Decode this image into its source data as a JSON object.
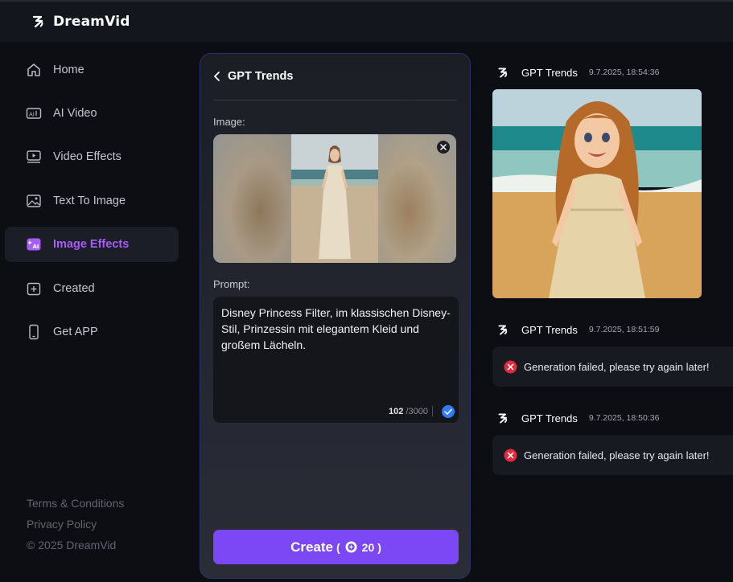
{
  "app": {
    "name": "DreamVid"
  },
  "sidebar": {
    "items": [
      {
        "label": "Home",
        "icon": "home-icon"
      },
      {
        "label": "AI Video",
        "icon": "ai-video-icon"
      },
      {
        "label": "Video Effects",
        "icon": "video-effects-icon"
      },
      {
        "label": "Text To Image",
        "icon": "text-to-image-icon"
      },
      {
        "label": "Image Effects",
        "icon": "image-effects-icon",
        "active": true
      },
      {
        "label": "Created",
        "icon": "created-icon"
      },
      {
        "label": "Get APP",
        "icon": "phone-icon"
      }
    ],
    "footer": {
      "terms": "Terms & Conditions",
      "privacy": "Privacy Policy",
      "copyright": "© 2025 DreamVid"
    }
  },
  "panel": {
    "title": "GPT Trends",
    "image_label": "Image:",
    "prompt_label": "Prompt:",
    "prompt_text": "Disney Princess Filter, im klassischen Disney-Stil, Prinzessin mit elegantem Kleid und großem Lächeln.",
    "char_count": "102",
    "char_max": "/3000",
    "create": {
      "label": "Create",
      "open": "(",
      "cost": "20",
      "close": ")"
    }
  },
  "feed": [
    {
      "name": "GPT Trends",
      "time": "9.7.2025, 18:54:36",
      "status": "success"
    },
    {
      "name": "GPT Trends",
      "time": "9.7.2025, 18:51:59",
      "status": "failed",
      "message": "Generation failed, please try again later!"
    },
    {
      "name": "GPT Trends",
      "time": "9.7.2025, 18:50:36",
      "status": "failed",
      "message": "Generation failed, please try again later!"
    }
  ],
  "colors": {
    "accent": "#7c47f5",
    "active_nav": "#a75cf7",
    "error": "#e5283b",
    "check": "#2f7cf6"
  }
}
